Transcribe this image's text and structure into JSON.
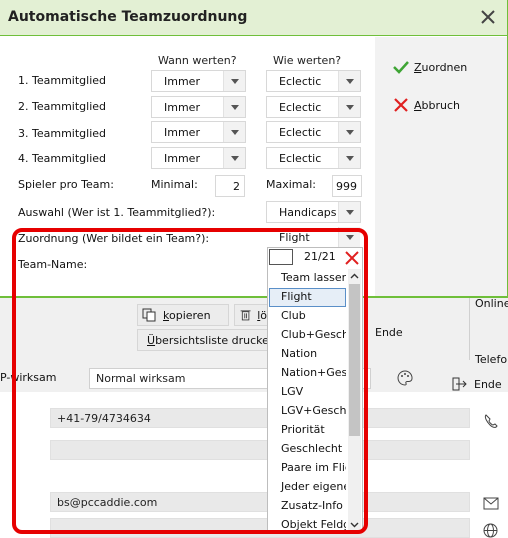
{
  "dialog": {
    "title": "Automatische Teamzuordnung",
    "col_when": "Wann werten?",
    "col_how": "Wie werten?",
    "rows": [
      {
        "label": "1. Teammitglied",
        "when": "Immer",
        "how": "Eclectic"
      },
      {
        "label": "2. Teammitglied",
        "when": "Immer",
        "how": "Eclectic"
      },
      {
        "label": "3. Teammitglied",
        "when": "Immer",
        "how": "Eclectic"
      },
      {
        "label": "4. Teammitglied",
        "when": "Immer",
        "how": "Eclectic"
      }
    ],
    "players_label": "Spieler pro Team:",
    "min_label": "Minimal:",
    "min_value": "2",
    "max_label": "Maximal:",
    "max_value": "999",
    "selection_label": "Auswahl (Wer ist 1. Teammitglied?):",
    "selection_value": "Handicaps",
    "assignment_label": "Zuordnung (Wer bildet ein Team?):",
    "assignment_value": "Flight",
    "team_name_label": "Team-Name:",
    "assign_button": "Zuordnen",
    "cancel_button": "Abbruch"
  },
  "dropdown": {
    "counter": "21/21",
    "options": [
      "Team lassen",
      "Flight",
      "Club",
      "Club+Geschlecht",
      "Nation",
      "Nation+Geschlecht",
      "LGV",
      "LGV+Geschlecht",
      "Priorität",
      "Geschlecht",
      "Paare im Flight",
      "Jeder eigenes Team",
      "Zusatz-Info",
      "Objekt Feldgeber"
    ],
    "selected_index": 1
  },
  "background": {
    "copy_button": "kopieren",
    "delete_button": "lö",
    "print_button": "Übersichtsliste drucken",
    "end_button": "Ende",
    "end_button_2": "Ende",
    "online_label": "Online",
    "phone_label": "Telefo",
    "wirksam_label": "P-wirksam",
    "wirksam_value": "Normal wirksam",
    "phone_value": "+41-79/4734634",
    "email_value": "bs@pccaddie.com"
  },
  "colors": {
    "accent_green": "#6fbf3a",
    "title_bg": "#e3f0d4",
    "annotation_red": "#e60000",
    "selection_border": "#5a8fc8"
  }
}
